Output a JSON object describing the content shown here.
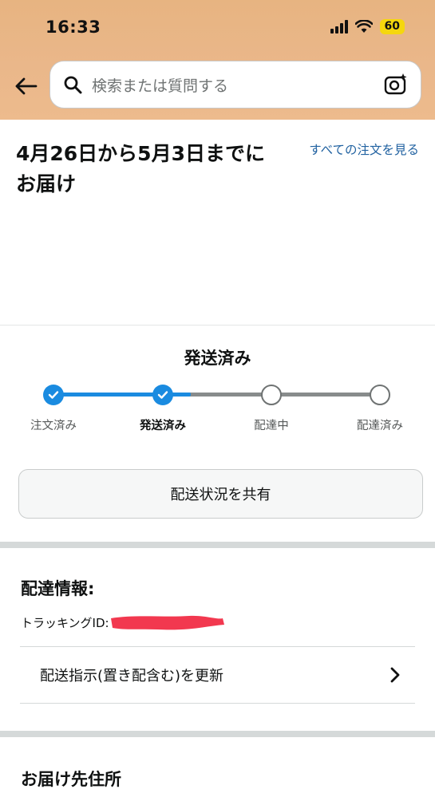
{
  "status_bar": {
    "time": "16:33",
    "battery": "60"
  },
  "search": {
    "placeholder": "検索または質問する"
  },
  "delivery": {
    "title": "4月26日から5月3日までにお届け",
    "all_orders_link": "すべての注文を見る"
  },
  "shipment": {
    "status": "発送済み",
    "progress_fraction": 0.42,
    "steps": [
      {
        "label": "注文済み",
        "state": "done"
      },
      {
        "label": "発送済み",
        "state": "current"
      },
      {
        "label": "配達中",
        "state": "todo"
      },
      {
        "label": "配達済み",
        "state": "todo"
      }
    ],
    "share_button": "配送状況を共有"
  },
  "delivery_info": {
    "title": "配達情報:",
    "tracking_label": "トラッキングID:",
    "instructions_link": "配送指示(置き配含む)を更新"
  },
  "address": {
    "title": "お届け先住所"
  },
  "colors": {
    "accent": "#1a8be0",
    "link": "#2162a1",
    "header_bg": "#e9b686"
  },
  "icons": [
    "back-arrow-icon",
    "search-icon",
    "camera-ai-icon",
    "check-icon",
    "chevron-right-icon",
    "wifi-icon",
    "signal-icon"
  ]
}
